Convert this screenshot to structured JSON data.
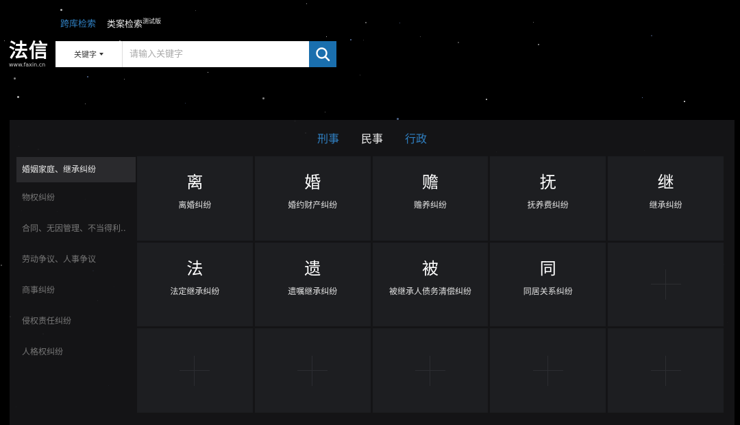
{
  "header": {
    "link_cross_search": "跨库检索",
    "link_case_search": "类案检索",
    "link_case_search_badge": "测试版"
  },
  "logo": {
    "main": "法信",
    "sub": "www.faxin.cn"
  },
  "search": {
    "type_selected": "关键字",
    "placeholder": "请输入关键字"
  },
  "tabs": [
    {
      "label": "刑事",
      "active": false
    },
    {
      "label": "民事",
      "active": true
    },
    {
      "label": "行政",
      "active": false
    }
  ],
  "sidebar": {
    "items": [
      {
        "label": "婚姻家庭、继承纠纷",
        "active": true
      },
      {
        "label": "物权纠纷"
      },
      {
        "label": "合同、无因管理、不当得利.."
      },
      {
        "label": "劳动争议、人事争议"
      },
      {
        "label": "商事纠纷"
      },
      {
        "label": "侵权责任纠纷"
      },
      {
        "label": "人格权纠纷"
      }
    ]
  },
  "grid": {
    "cells": [
      {
        "char": "离",
        "label": "离婚纠纷"
      },
      {
        "char": "婚",
        "label": "婚约财产纠纷"
      },
      {
        "char": "赡",
        "label": "赡养纠纷"
      },
      {
        "char": "抚",
        "label": "抚养费纠纷"
      },
      {
        "char": "继",
        "label": "继承纠纷"
      },
      {
        "char": "法",
        "label": "法定继承纠纷"
      },
      {
        "char": "遗",
        "label": "遗嘱继承纠纷"
      },
      {
        "char": "被",
        "label": "被继承人债务清偿纠纷"
      },
      {
        "char": "同",
        "label": "同居关系纠纷"
      }
    ],
    "empty_count": 6
  },
  "colors": {
    "accent": "#2f7fc1",
    "search_button": "#1a6fae",
    "background": "#000000"
  }
}
